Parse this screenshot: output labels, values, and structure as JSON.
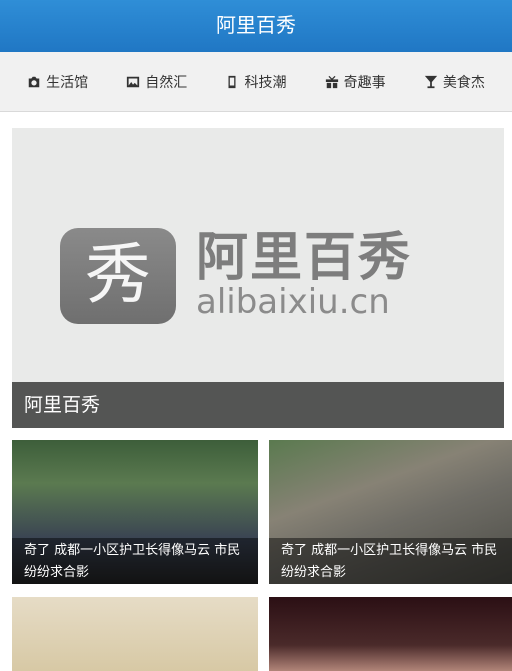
{
  "header": {
    "title": "阿里百秀"
  },
  "nav": {
    "items": [
      {
        "label": "生活馆",
        "icon": "camera-icon"
      },
      {
        "label": "自然汇",
        "icon": "image-icon"
      },
      {
        "label": "科技潮",
        "icon": "mobile-icon"
      },
      {
        "label": "奇趣事",
        "icon": "gift-icon"
      },
      {
        "label": "美食杰",
        "icon": "glass-icon"
      }
    ]
  },
  "banner": {
    "logo_char": "秀",
    "logo_text_cn": "阿里百秀",
    "logo_text_en": "alibaixiu.cn",
    "caption": "阿里百秀"
  },
  "cards": [
    {
      "title": "奇了 成都一小区护卫长得像马云 市民纷纷求合影"
    },
    {
      "title": "奇了 成都一小区护卫长得像马云 市民纷纷求合影"
    },
    {
      "title": ""
    },
    {
      "title": ""
    }
  ]
}
